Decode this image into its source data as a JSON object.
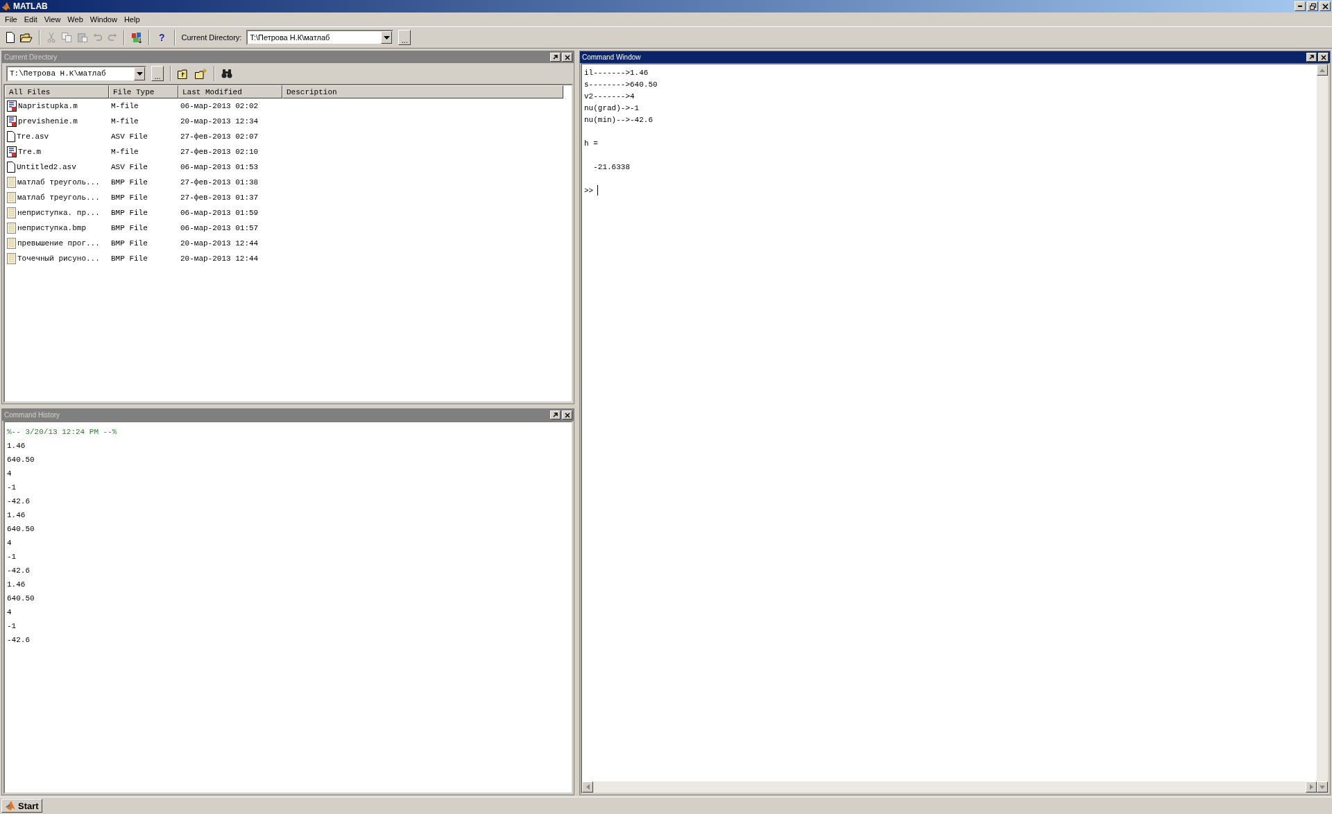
{
  "window": {
    "title": "MATLAB"
  },
  "menu": [
    "File",
    "Edit",
    "View",
    "Web",
    "Window",
    "Help"
  ],
  "toolbar": {
    "help_label": "?",
    "directory_label": "Current Directory:",
    "directory_value": "T:\\Петрова Н.К\\матлаб",
    "browse_label": "..."
  },
  "current_directory": {
    "title": "Current Directory",
    "path": "T:\\Петрова Н.К\\матлаб",
    "browse_label": "...",
    "columns": [
      "All Files",
      "File Type",
      "Last Modified",
      "Description"
    ],
    "files": [
      {
        "name": "Napristupka.m",
        "type": "M-file",
        "modified": "06-мар-2013 02:02",
        "kind": "mfile"
      },
      {
        "name": "previshenie.m",
        "type": "M-file",
        "modified": "20-мар-2013 12:34",
        "kind": "mfile"
      },
      {
        "name": "Tre.asv",
        "type": "ASV File",
        "modified": "27-фев-2013 02:07",
        "kind": "doc"
      },
      {
        "name": "Tre.m",
        "type": "M-file",
        "modified": "27-фев-2013 02:10",
        "kind": "mfile"
      },
      {
        "name": "Untitled2.asv",
        "type": "ASV File",
        "modified": "06-мар-2013 01:53",
        "kind": "doc"
      },
      {
        "name": "матлаб треуголь...",
        "type": "BMP File",
        "modified": "27-фев-2013 01:38",
        "kind": "bmp"
      },
      {
        "name": "матлаб треуголь...",
        "type": "BMP File",
        "modified": "27-фев-2013 01:37",
        "kind": "bmp"
      },
      {
        "name": "неприступка. пр...",
        "type": "BMP File",
        "modified": "06-мар-2013 01:59",
        "kind": "bmp"
      },
      {
        "name": "неприступка.bmp",
        "type": "BMP File",
        "modified": "06-мар-2013 01:57",
        "kind": "bmp"
      },
      {
        "name": "превышение прог...",
        "type": "BMP File",
        "modified": "20-мар-2013 12:44",
        "kind": "bmp"
      },
      {
        "name": "Точечный рисуно...",
        "type": "BMP File",
        "modified": "20-мар-2013 12:44",
        "kind": "bmp"
      }
    ]
  },
  "command_history": {
    "title": "Command History",
    "session_header": "%-- 3/20/13 12:24 PM --%",
    "entries": [
      "1.46",
      "640.50",
      "4",
      "-1",
      "-42.6",
      "1.46",
      "640.50",
      "4",
      "-1",
      "-42.6",
      "1.46",
      "640.50",
      "4",
      "-1",
      "-42.6"
    ]
  },
  "command_window": {
    "title": "Command Window",
    "output_blocks": [
      [
        "il------->1.46",
        "s-------->640.50",
        "v2------->4",
        "nu(grad)->-1",
        "nu(min)-->-42.6"
      ],
      [
        "h ="
      ],
      [
        "  -21.6338"
      ]
    ],
    "prompt": ">>"
  },
  "start_button": {
    "label": "Start"
  }
}
